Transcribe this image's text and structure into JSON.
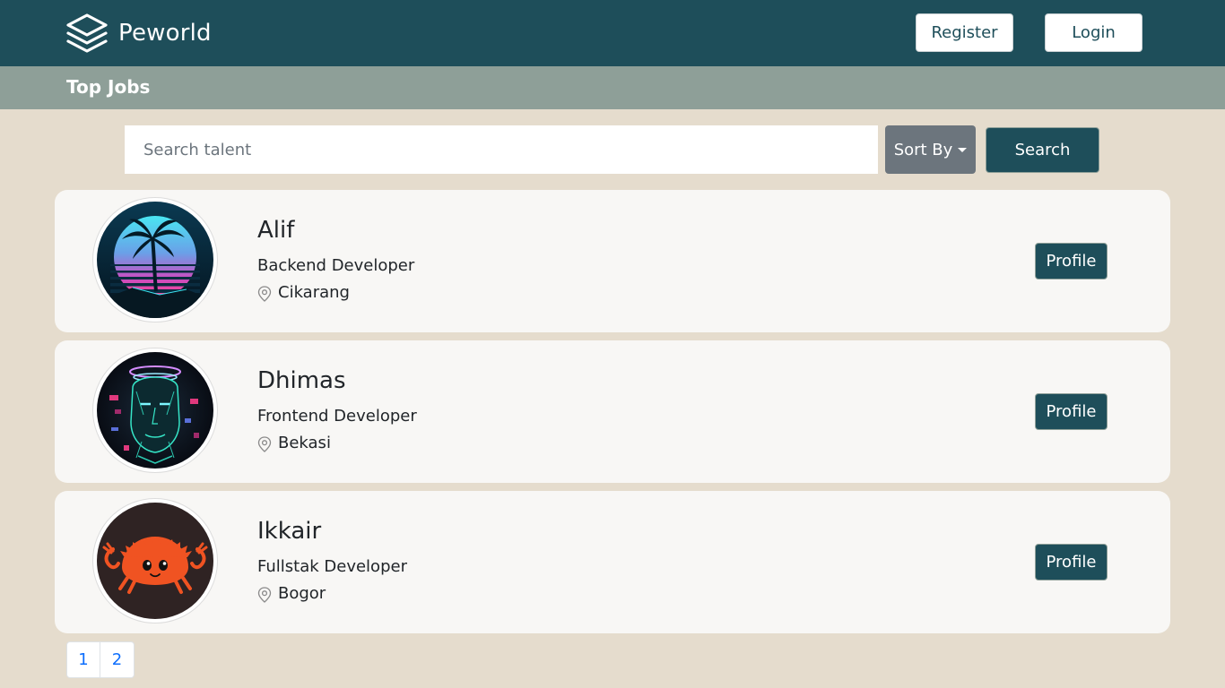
{
  "navbar": {
    "brand": "Peworld",
    "register_label": "Register",
    "login_label": "Login"
  },
  "subbar": {
    "title": "Top Jobs"
  },
  "search": {
    "placeholder": "Search talent",
    "sort_label": "Sort By",
    "button_label": "Search"
  },
  "talents": [
    {
      "name": "Alif",
      "role": "Backend Developer",
      "location": "Cikarang",
      "profile_label": "Profile",
      "avatar": "synthwave-palm-avatar"
    },
    {
      "name": "Dhimas",
      "role": "Frontend Developer",
      "location": "Bekasi",
      "profile_label": "Profile",
      "avatar": "cyberpunk-face-avatar"
    },
    {
      "name": "Ikkair",
      "role": "Fullstak Developer",
      "location": "Bogor",
      "profile_label": "Profile",
      "avatar": "orange-crab-avatar"
    }
  ],
  "pagination": {
    "pages": [
      "1",
      "2"
    ]
  },
  "colors": {
    "navbar": "#1e4e5a",
    "subbar": "#8e9f98",
    "background": "#e5dccd",
    "card": "#f8f7f5",
    "sort_button": "#6c757d",
    "page_link": "#0d6efd"
  },
  "icons": {
    "brand": "layers-icon",
    "location": "map-pin-icon",
    "sort": "caret-down-icon"
  }
}
